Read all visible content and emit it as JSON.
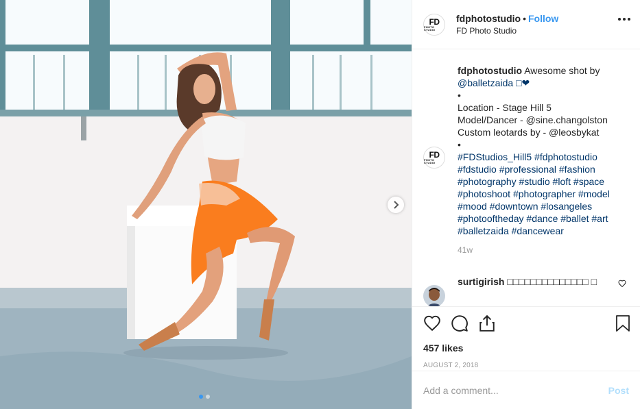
{
  "header": {
    "avatar_text_big": "FD",
    "avatar_text_small": "PHOTO STUDIO",
    "username": "fdphotostudio",
    "separator": "•",
    "follow_label": "Follow",
    "location": "FD Photo Studio",
    "more_icon": "more-horizontal-icon"
  },
  "caption": {
    "username": "fdphotostudio",
    "lines": [
      " Awesome shot by",
      "@balletzaida □❤",
      "•",
      "Location - Stage Hill 5",
      "Model/Dancer - @sine.changolston",
      "Custom leotards by - @leosbykat",
      "•",
      "#FDStudios_Hill5 #fdphotostudio",
      "#fdstudio #professional #fashion",
      "#photography #studio #loft #space",
      "#photoshoot #photographer #model",
      "#mood #downtown #losangeles",
      "#photooftheday #dance #ballet #art",
      "#balletzaida #dancewear"
    ],
    "time_ago": "41w"
  },
  "comment": {
    "username": "surtigirish",
    "text": " □□□□□□□□□□□□□□ □"
  },
  "actions": {
    "likes": "457 likes",
    "date": "AUGUST 2, 2018",
    "comment_placeholder": "Add a comment...",
    "post_label": "Post"
  },
  "carousel": {
    "current": 1,
    "total": 2
  },
  "colors": {
    "accent": "#3897f0",
    "link": "#003569",
    "muted": "#999999",
    "post_disabled": "#b2dffc"
  }
}
